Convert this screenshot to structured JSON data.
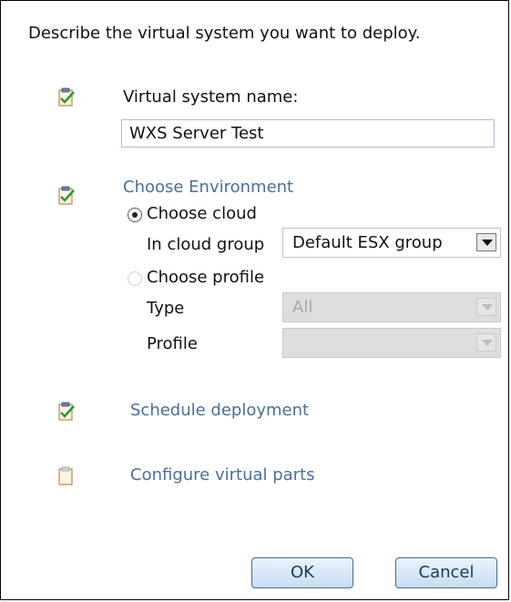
{
  "dialog": {
    "intro": "Describe the virtual system you want to deploy."
  },
  "steps": {
    "name": {
      "label": "Virtual system name:",
      "value": "WXS Server Test",
      "icon": "clipboard-check-icon"
    },
    "environment": {
      "label": "Choose Environment",
      "icon": "clipboard-check-icon",
      "cloud_option": "Choose cloud",
      "cloud_group_label": "In cloud group",
      "cloud_group_value": "Default ESX group",
      "profile_option": "Choose profile",
      "type_label": "Type",
      "type_value": "All",
      "profile_label": "Profile",
      "profile_value": ""
    },
    "schedule": {
      "label": "Schedule deployment",
      "icon": "clipboard-check-icon"
    },
    "parts": {
      "label": "Configure virtual parts",
      "icon": "clipboard-empty-icon"
    }
  },
  "buttons": {
    "ok": "OK",
    "cancel": "Cancel"
  },
  "colors": {
    "link": "#4a6f99",
    "check": "#2e9a2e",
    "button_border": "#3d6d9a"
  }
}
